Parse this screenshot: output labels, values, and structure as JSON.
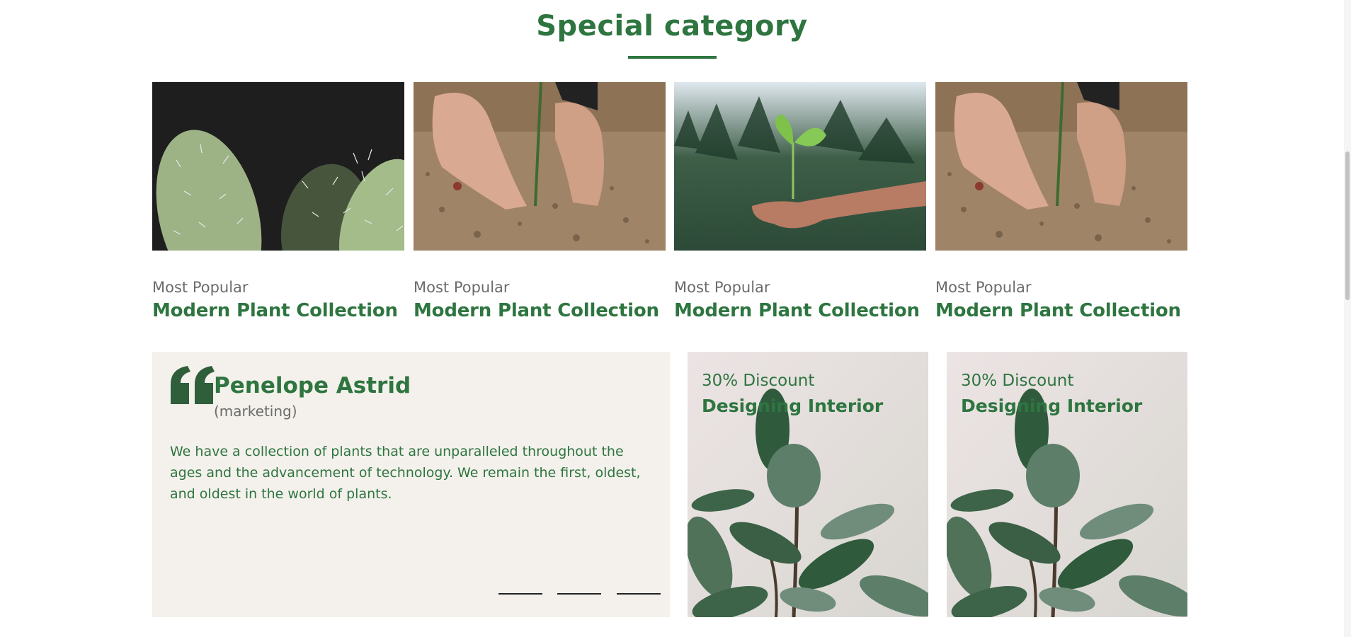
{
  "section": {
    "title": "Special category"
  },
  "categories": [
    {
      "label": "Most Popular",
      "title": "Modern Plant Collection",
      "image": "cactus-photo"
    },
    {
      "label": "Most Popular",
      "title": "Modern Plant Collection",
      "image": "planting-hands-photo"
    },
    {
      "label": "Most Popular",
      "title": "Modern Plant Collection",
      "image": "seedling-hand-photo"
    },
    {
      "label": "Most Popular",
      "title": "Modern Plant Collection",
      "image": "planting-hands-photo"
    }
  ],
  "testimonial": {
    "name": "Penelope Astrid",
    "role": "(marketing)",
    "text": "We have a collection of plants that are unparalleled throughout the ages and the advancement of technology. We remain the first, oldest, and oldest in the world of plants.",
    "quote_icon": "quote-icon",
    "slider_count": 3
  },
  "promos": [
    {
      "discount": "30% Discount",
      "title": "Designing Interior",
      "image": "rubber-plant-photo"
    },
    {
      "discount": "30% Discount",
      "title": "Designing Interior",
      "image": "rubber-plant-photo"
    }
  ],
  "colors": {
    "accent_green": "#2e7540",
    "muted_text": "#6b6b6b",
    "testimonial_bg": "#f4f1ec"
  }
}
